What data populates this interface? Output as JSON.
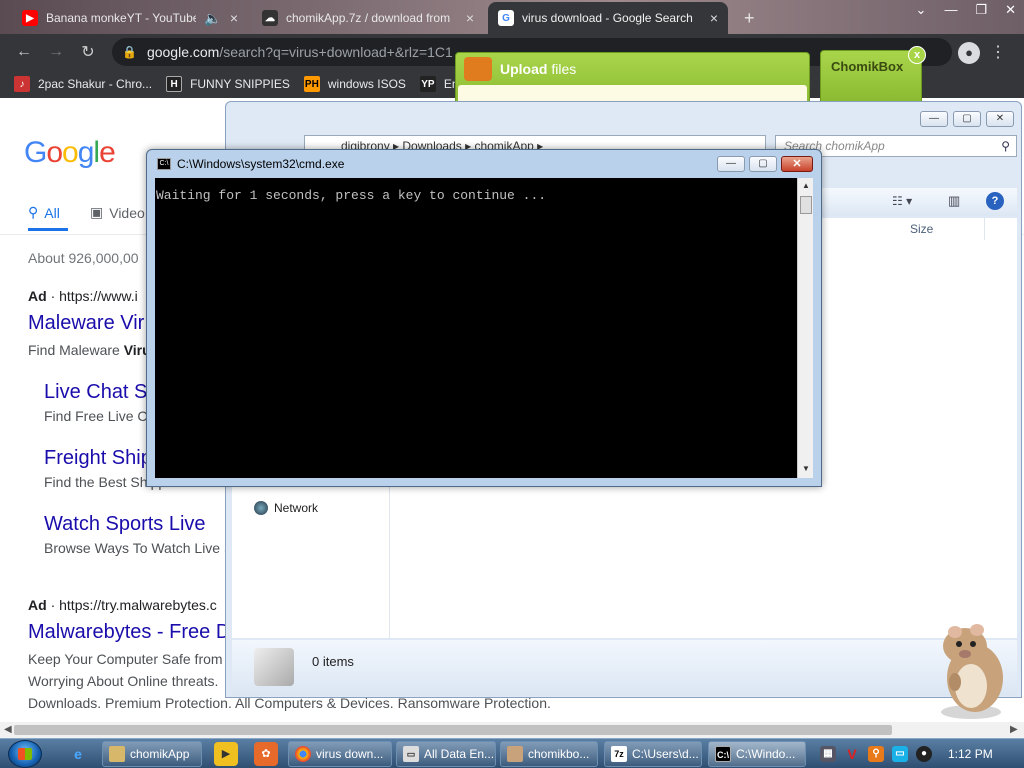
{
  "browser": {
    "tabs": [
      {
        "label": "Banana monkeYT - YouTube",
        "icon": "youtube-icon"
      },
      {
        "label": "chomikApp.7z / download from",
        "icon": "cloud-icon"
      },
      {
        "label": "virus download - Google Search",
        "icon": "google-icon"
      }
    ],
    "new_tab": "+",
    "url_main": "google.com",
    "url_rest": "/search?q=virus+download+&rlz=1C1",
    "bookmarks": [
      {
        "label": "2pac Shakur - Chro...",
        "icon": "bookmark-icon"
      },
      {
        "label": "FUNNY SNIPPIES",
        "icon": "h-logo-icon"
      },
      {
        "label": "windows ISOS",
        "icon": "ph-logo-icon"
      },
      {
        "label": "End",
        "icon": "yp-logo-icon"
      }
    ]
  },
  "google": {
    "logo": [
      "G",
      "o",
      "o",
      "g",
      "l",
      "e"
    ],
    "tabs": [
      "All",
      "Video"
    ],
    "result_count": "About 926,000,00",
    "ad1": {
      "ad_label": "Ad",
      "url": "https://www.i",
      "title": "Maleware Vir",
      "desc_prefix": "Find Maleware ",
      "desc_bold": "Viru"
    },
    "sublinks": [
      {
        "title": "Live Chat S",
        "desc": "Find Free Live Ch"
      },
      {
        "title": "Freight Ship",
        "desc": "Find the Best Shipp"
      },
      {
        "title": "Watch Sports Live",
        "desc": "Browse Ways To Watch Live S"
      }
    ],
    "ad2": {
      "ad_label": "Ad",
      "url": "https://try.malwarebytes.c",
      "title": "Malwarebytes - Free D",
      "desc1": "Keep Your Computer Safe from",
      "desc2": "Worrying About Online threats.",
      "desc3": "Downloads. Premium Protection. All Computers & Devices. Ransomware Protection."
    }
  },
  "upload": {
    "title_bold": "Upload",
    "title_rest": " files"
  },
  "chomikbox": {
    "title": "ChomikBox",
    "close": "x"
  },
  "explorer": {
    "address": "digibrony  ▸  Downloads  ▸  chomikApp  ▸",
    "search_placeholder": "Search chomikApp",
    "column_size": "Size",
    "nav_network": "Network",
    "status_count": "0 items"
  },
  "cmd": {
    "title": "C:\\Windows\\system32\\cmd.exe",
    "output": "Waiting for 1 seconds, press a key to continue ..."
  },
  "taskbar": {
    "items": [
      {
        "label": "chomikApp",
        "icon": "folder-icon"
      },
      {
        "label": "virus down...",
        "icon": "chrome-icon"
      },
      {
        "label": "All Data En...",
        "icon": "window-icon"
      },
      {
        "label": "chomikbo...",
        "icon": "hamster-icon"
      },
      {
        "label": "C:\\Users\\d...",
        "icon": "7zip-icon"
      },
      {
        "label": "C:\\Windo...",
        "icon": "cmd-icon"
      }
    ],
    "clock": "1:12 PM"
  },
  "colors": {
    "chrome_dark": "#35363a",
    "google_link": "#1a0dab",
    "google_blue": "#1a73e8",
    "chomik_green": "#a8d548",
    "taskbar": "#2f4f72"
  }
}
